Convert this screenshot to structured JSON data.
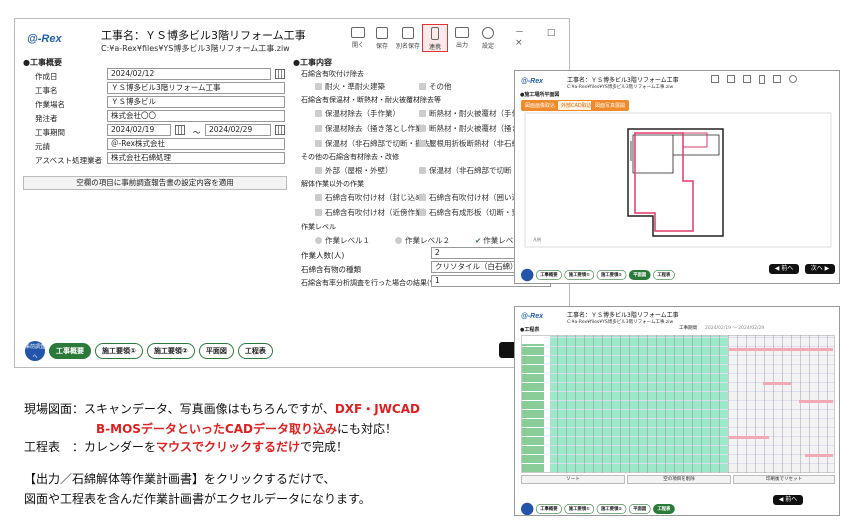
{
  "main_window": {
    "app_logo": "@-Rex",
    "title": "工事名：ＹＳ博多ビル3階リフォーム工事",
    "path": "C:¥a-Rex¥files¥YS博多ビル3階リフォーム工事.ziw",
    "toolbar": [
      "開く",
      "保存",
      "別名保存",
      "連携",
      "出力",
      "設定"
    ],
    "window_controls": "－ □ ×",
    "left": {
      "section_title": "●工事概要",
      "fields": [
        {
          "label": "作成日",
          "value": "2024/02/12"
        },
        {
          "label": "工事名",
          "value": "ＹＳ博多ビル3階リフォーム工事"
        },
        {
          "label": "作業場名",
          "value": "ＹＳ博多ビル"
        },
        {
          "label": "発注者",
          "value": "株式会社〇〇"
        },
        {
          "label": "工事期間",
          "value": "2024/02/19"
        },
        {
          "label": "元請",
          "value": "＠-Rex株式会社"
        },
        {
          "label": "アスベスト処理業者",
          "value": "株式会社石綿処理"
        }
      ],
      "period_end": "2024/02/29",
      "period_sep": "～",
      "apply_button": "空欄の項目に事前調査報告書の設定内容を適用"
    },
    "right": {
      "section_title": "●工事内容",
      "groups": [
        {
          "title": "石綿含有吹付け除去",
          "items": [
            "耐火・準耐火建築",
            "その他"
          ]
        },
        {
          "title": "石綿含有保温材・断熱材・耐火被覆材除去等",
          "items": [
            "保温材除去（手作業）",
            "断熱材・耐火被覆材（手作業",
            "保温材除去（掻き落とし作業）",
            "断熱材・耐火被覆材（掻き落",
            "保温材（非石綿部で切断・撤去）",
            "屋根用折板断熱材（非石綿部"
          ]
        },
        {
          "title": "その他の石綿含有材除去・改修",
          "items": [
            "外部（屋根・外壁）",
            "保温材（非石綿部で切断・撤"
          ]
        },
        {
          "title": "解体作業以外の作業",
          "items": [
            "石綿含有吹付け材（封じ込め）",
            "石綿含有吹付け材（囲い込み",
            "石綿含有吹付け材（近傍作業）",
            "石綿含有成形板（切断・穿孔"
          ]
        }
      ],
      "level_title": "作業レベル",
      "levels": [
        "作業レベル１",
        "作業レベル２",
        "作業レベル"
      ],
      "people_label": "作業人数(人)",
      "people_value": "2",
      "material_label": "石綿含有物の種類",
      "material_value": "クリソタイル（白石綿）",
      "analysis_label": "石綿含有率分析調査を行った場合の結果(%)",
      "analysis_value": "1"
    },
    "nav": {
      "circle_label": "事前調査へ",
      "tabs": [
        "工事概要",
        "施工要領①",
        "施工要領②",
        "平面図",
        "工程表"
      ]
    }
  },
  "plan_window": {
    "title": "工事名：ＹＳ博多ビル3階リフォーム工事",
    "path": "C:¥a-Rex¥files¥YS博多ビル3階リフォーム工事.ziw",
    "section": "●施工場所平面図",
    "tabs": [
      "図面画像取込",
      "外部CAD取込",
      "図面写真展開"
    ],
    "nav_tabs": [
      "工事概要",
      "施工要領①",
      "施工要領②",
      "平面図",
      "工程表"
    ],
    "prev": "◀ 前へ",
    "next": "次へ ▶"
  },
  "schedule_window": {
    "title": "工事名：ＹＳ博多ビル3階リフォーム工事",
    "path": "C:¥a-Rex¥files¥YS博多ビル3階リフォーム工事.ziw",
    "section": "●工程表",
    "period_label": "工事期間",
    "period": "2024/02/19 ～ 2024/02/29",
    "bottom_buttons": [
      "ソート",
      "空の項目を削除",
      "印刷後でリセット"
    ],
    "nav_tabs": [
      "工事概要",
      "施工要領①",
      "施工要領②",
      "平面図",
      "工程表"
    ],
    "prev": "◀ 前へ"
  },
  "caption": {
    "line1_a": "現場図面：スキャンデータ、写真画像はもちろんですが、",
    "line1_red": "DXF・JWCAD",
    "line2_red": "B-MOSデータといったCADデータ取り込み",
    "line2_b": "にも対応！",
    "line3_a": "工程表　：カレンダーを",
    "line3_red": "マウスでクリックするだけ",
    "line3_b": "で完成！",
    "line4": "【出力／石綿解体等作業計画書】をクリックするだけで、",
    "line5": "図面や工程表を含んだ作業計画書がエクセルデータになります。"
  }
}
